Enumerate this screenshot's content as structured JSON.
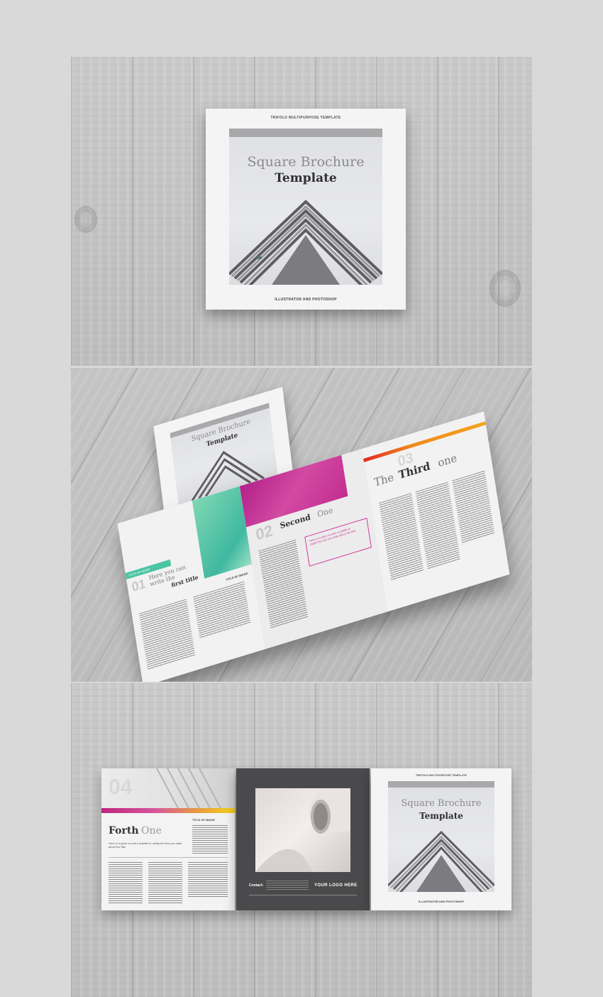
{
  "cover": {
    "top_label": "TRIFOLD MULTIPURPOSE TEMPLATE",
    "title_light": "Square Brochure",
    "title_bold": "Template",
    "bottom_label": "ILLUSTRATOR AND PHOTOSHOP"
  },
  "spread_inside": {
    "small_cover_title_light": "Square Brochure",
    "small_cover_title_bold": "Template",
    "panel1_tag": "TITLE OF IMAGE",
    "panel1_number": "01",
    "panel1_heading_light": "Here you can write the",
    "panel1_heading_bold": "first title",
    "panel1_image_caption": "TITLE OF IMAGE",
    "panel2_number": "02",
    "panel2_heading_bold": "Second",
    "panel2_heading_light": "One",
    "panel2_box_text": "Here is a place to add a subtitle to clarify the text you write about the title",
    "panel3_number": "03",
    "panel3_heading_light": "The",
    "panel3_heading_bold": "Third",
    "panel3_heading_end": "one"
  },
  "spread_outside": {
    "page4_number": "04",
    "page4_heading_bold": "Forth",
    "page4_heading_light": "One",
    "page4_image_title": "TITLE OF IMAGE",
    "page4_subtitle": "Here is a place to add a subtitle to clarify the text you write about the title",
    "contact_label": "Contact:",
    "logo_label": "YOUR LOGO HERE",
    "front_top_label": "TRIFOLD MULTIPURPOSE TEMPLATE",
    "front_title_light": "Square Brochure",
    "front_title_bold": "Template",
    "front_bottom_label": "ILLUSTRATOR AND PHOTOSHOP"
  },
  "colors": {
    "teal": "#4cc5a4",
    "magenta": "#c02b8d",
    "orange": "#f08a1c",
    "yellow": "#f5d21a",
    "dark_panel": "#4a4a4c"
  }
}
